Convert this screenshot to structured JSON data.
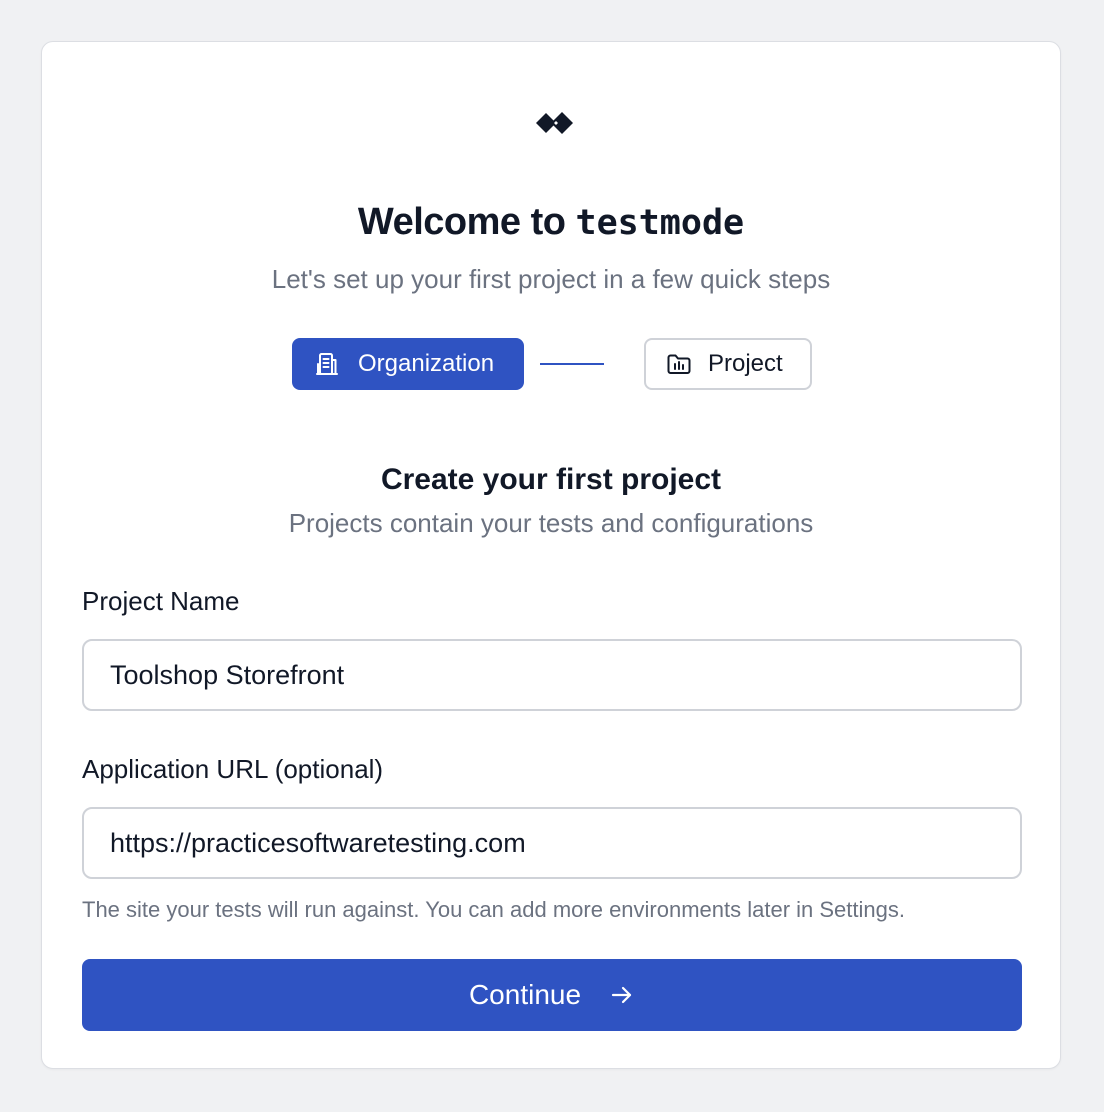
{
  "brand": {
    "logo_icon": "testmode-diamond-logo-icon",
    "title_prefix": "Welcome to ",
    "title_product": "testmode",
    "subtitle": "Let's set up your first project in a few quick steps"
  },
  "stepper": {
    "steps": [
      {
        "label": "Organization",
        "icon": "building-icon",
        "state": "active"
      },
      {
        "label": "Project",
        "icon": "folder-icon",
        "state": "upcoming"
      }
    ]
  },
  "form": {
    "title": "Create your first project",
    "subtitle": "Projects contain your tests and configurations",
    "project_name": {
      "label": "Project Name",
      "value": "Toolshop Storefront"
    },
    "app_url": {
      "label": "Application URL (optional)",
      "value": "https://practicesoftwaretesting.com",
      "help": "The site your tests will run against. You can add more environments later in Settings."
    },
    "submit_label": "Continue",
    "submit_icon": "arrow-right-icon"
  },
  "colors": {
    "accent": "#2f53c2",
    "background": "#f0f1f3",
    "muted_text": "#6b7280",
    "border": "#cfd2d8"
  }
}
